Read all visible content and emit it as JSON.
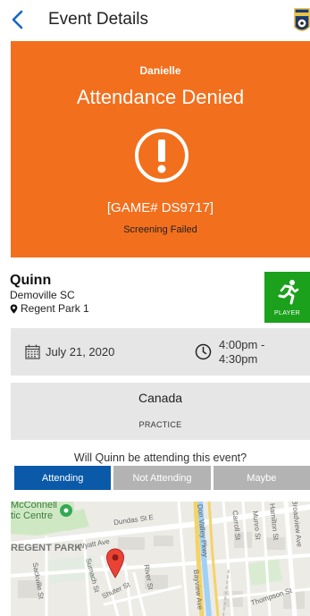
{
  "header": {
    "title": "Event Details",
    "back_icon": "chevron-left-icon",
    "logo_icon": "league-logo-icon"
  },
  "banner": {
    "background": "#f26f1d",
    "name": "Danielle",
    "status": "Attendance Denied",
    "icon": "alert-exclamation-icon",
    "game_code": "[GAME# DS9717]",
    "reason": "Screening Failed"
  },
  "player": {
    "name": "Quinn",
    "team": "Demoville SC",
    "location": "Regent Park 1",
    "location_icon": "map-pin-icon",
    "role": "PLAYER",
    "role_icon": "runner-icon",
    "role_color": "#1ba11b"
  },
  "event": {
    "date": "July 21, 2020",
    "date_icon": "calendar-icon",
    "time": "4:00pm - 4:30pm",
    "time_icon": "clock-icon",
    "country": "Canada",
    "type": "PRACTICE"
  },
  "attendance": {
    "question": "Will Quinn be attending this event?",
    "options": [
      "Attending",
      "Not Attending",
      "Maybe"
    ],
    "selected": "Attending",
    "active_color": "#0b5aa9"
  },
  "map": {
    "labels": {
      "park_name_1": "McConnell",
      "park_name_2": "tic Centre",
      "area": "REGENT PARK",
      "dundas": "Dundas St E",
      "wyatt": "Wyatt Ave",
      "sumach": "Sumach St",
      "shuter": "Shuter St",
      "river": "River St",
      "sackville": "Sackville St",
      "dvp": "Don Valley Pkwy",
      "carroll": "Carroll St",
      "munro": "Munro St",
      "hamilton": "Hamilton St",
      "broadview": "Broadview Ave",
      "bayview": "Bayview Ave",
      "thompson": "Thompson St"
    },
    "pin_icon": "map-marker-icon"
  }
}
